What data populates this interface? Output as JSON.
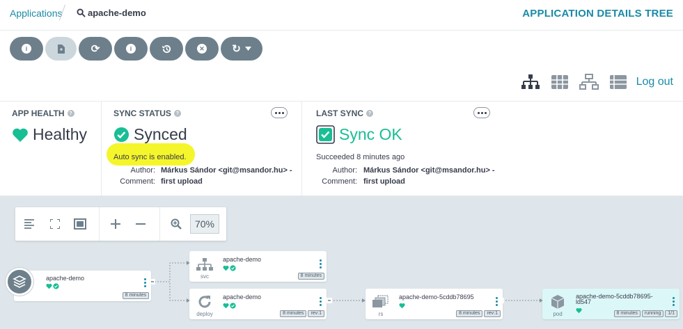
{
  "breadcrumb": {
    "applications": "Applications",
    "app_name": "apache-demo"
  },
  "page_title": "APPLICATION DETAILS TREE",
  "toolbar": {
    "buttons": [
      {
        "name": "details",
        "icon": "info-icon"
      },
      {
        "name": "diff",
        "icon": "file-diff-icon"
      },
      {
        "name": "sync",
        "icon": "sync-icon"
      },
      {
        "name": "sync-status",
        "icon": "info-icon"
      },
      {
        "name": "history",
        "icon": "history-icon"
      },
      {
        "name": "delete",
        "icon": "close-circle-icon"
      },
      {
        "name": "refresh",
        "icon": "refresh-icon"
      }
    ],
    "logout": "Log out"
  },
  "app_health": {
    "label": "APP HEALTH",
    "value": "Healthy",
    "color": "#18be94"
  },
  "sync_status": {
    "label": "SYNC STATUS",
    "value": "Synced",
    "auto_sync": "Auto sync is enabled.",
    "author_label": "Author:",
    "author": "Márkus Sándor <git@msandor.hu> -",
    "comment_label": "Comment:",
    "comment": "first upload"
  },
  "last_sync": {
    "label": "LAST SYNC",
    "value": "Sync OK",
    "succeeded": "Succeeded 8 minutes ago",
    "author_label": "Author:",
    "author": "Márkus Sándor <git@msandor.hu> -",
    "comment_label": "Comment:",
    "comment": "first upload"
  },
  "graph": {
    "zoom": "70%",
    "nodes": {
      "app": {
        "name": "apache-demo",
        "tags": [
          "8 minutes"
        ]
      },
      "svc": {
        "name": "apache-demo",
        "kind": "svc",
        "tags": [
          "8 minutes"
        ]
      },
      "deploy": {
        "name": "apache-demo",
        "kind": "deploy",
        "tags": [
          "8 minutes",
          "rev:1"
        ]
      },
      "rs": {
        "name": "apache-demo-5cddb78695",
        "kind": "rs",
        "tags": [
          "8 minutes",
          "rev:1"
        ]
      },
      "pod": {
        "name_line1": "apache-demo-5cddb78695-",
        "name_line2": "ld547",
        "kind": "pod",
        "tags": [
          "8 minutes",
          "running",
          "1/1"
        ]
      }
    }
  },
  "colors": {
    "accent": "#1a8aa6",
    "ok": "#18be94",
    "button": "#6d7f8b"
  }
}
